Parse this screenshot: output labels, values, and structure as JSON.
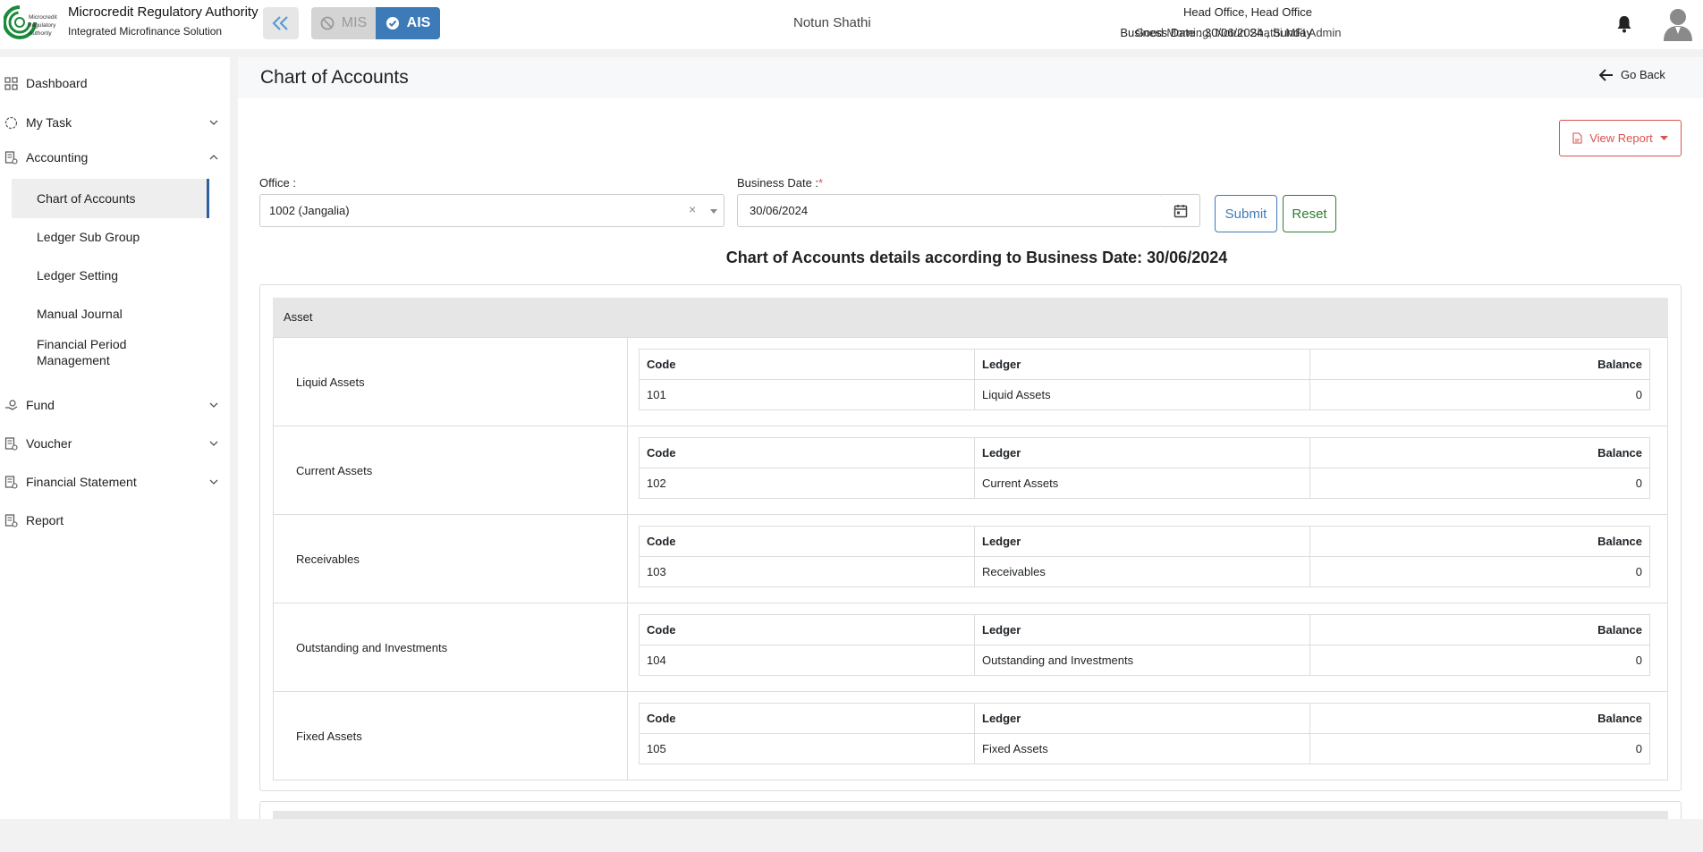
{
  "header": {
    "brand_title": "Microcredit Regulatory Authority",
    "brand_subtitle": "Integrated Microfinance Solution",
    "logo_text": [
      "Microcredit",
      "Regulatory",
      "Authority"
    ],
    "mode_mis": "MIS",
    "mode_ais": "AIS",
    "org_name": "Notun Shathi",
    "greeting": "Good Morning, Notun Shathi MFI Admin",
    "office": "Head Office, Head Office",
    "business_date": "Business Date : 30/06/2024 , Sunday"
  },
  "sidebar": {
    "items": [
      {
        "label": "Dashboard",
        "icon": "dashboard-icon"
      },
      {
        "label": "My Task",
        "icon": "task-icon"
      },
      {
        "label": "Accounting",
        "icon": "accounting-icon",
        "expanded": true
      },
      {
        "label": "Fund",
        "icon": "fund-icon"
      },
      {
        "label": "Voucher",
        "icon": "voucher-icon"
      },
      {
        "label": "Financial Statement",
        "icon": "statement-icon"
      },
      {
        "label": "Report",
        "icon": "report-icon"
      }
    ],
    "accounting_sub": [
      {
        "label": "Chart of Accounts",
        "active": true
      },
      {
        "label": "Ledger Sub Group"
      },
      {
        "label": "Ledger Setting"
      },
      {
        "label": "Manual Journal"
      },
      {
        "label": "Financial Period Management"
      }
    ]
  },
  "page": {
    "title": "Chart of Accounts",
    "go_back": "Go Back",
    "view_report": "View Report"
  },
  "form": {
    "office_label": "Office :",
    "office_value": "1002 (Jangalia)",
    "date_label": "Business Date :",
    "date_required": "*",
    "date_value": "30/06/2024",
    "submit": "Submit",
    "reset": "Reset"
  },
  "details": {
    "heading": "Chart of Accounts details according to Business Date: 30/06/2024",
    "group": "Asset",
    "columns": {
      "code": "Code",
      "ledger": "Ledger",
      "balance": "Balance"
    },
    "subgroups": [
      {
        "name": "Liquid Assets",
        "code": "101",
        "ledger": "Liquid Assets",
        "balance": "0"
      },
      {
        "name": "Current Assets",
        "code": "102",
        "ledger": "Current Assets",
        "balance": "0"
      },
      {
        "name": "Receivables",
        "code": "103",
        "ledger": "Receivables",
        "balance": "0"
      },
      {
        "name": "Outstanding and Investments",
        "code": "104",
        "ledger": "Outstanding and Investments",
        "balance": "0"
      },
      {
        "name": "Fixed Assets",
        "code": "105",
        "ledger": "Fixed Assets",
        "balance": "0"
      }
    ]
  },
  "colors": {
    "primary": "#3d7ab8",
    "danger": "#d9534f",
    "success": "#2e7d32",
    "logo_green": "#1b8a3a"
  }
}
